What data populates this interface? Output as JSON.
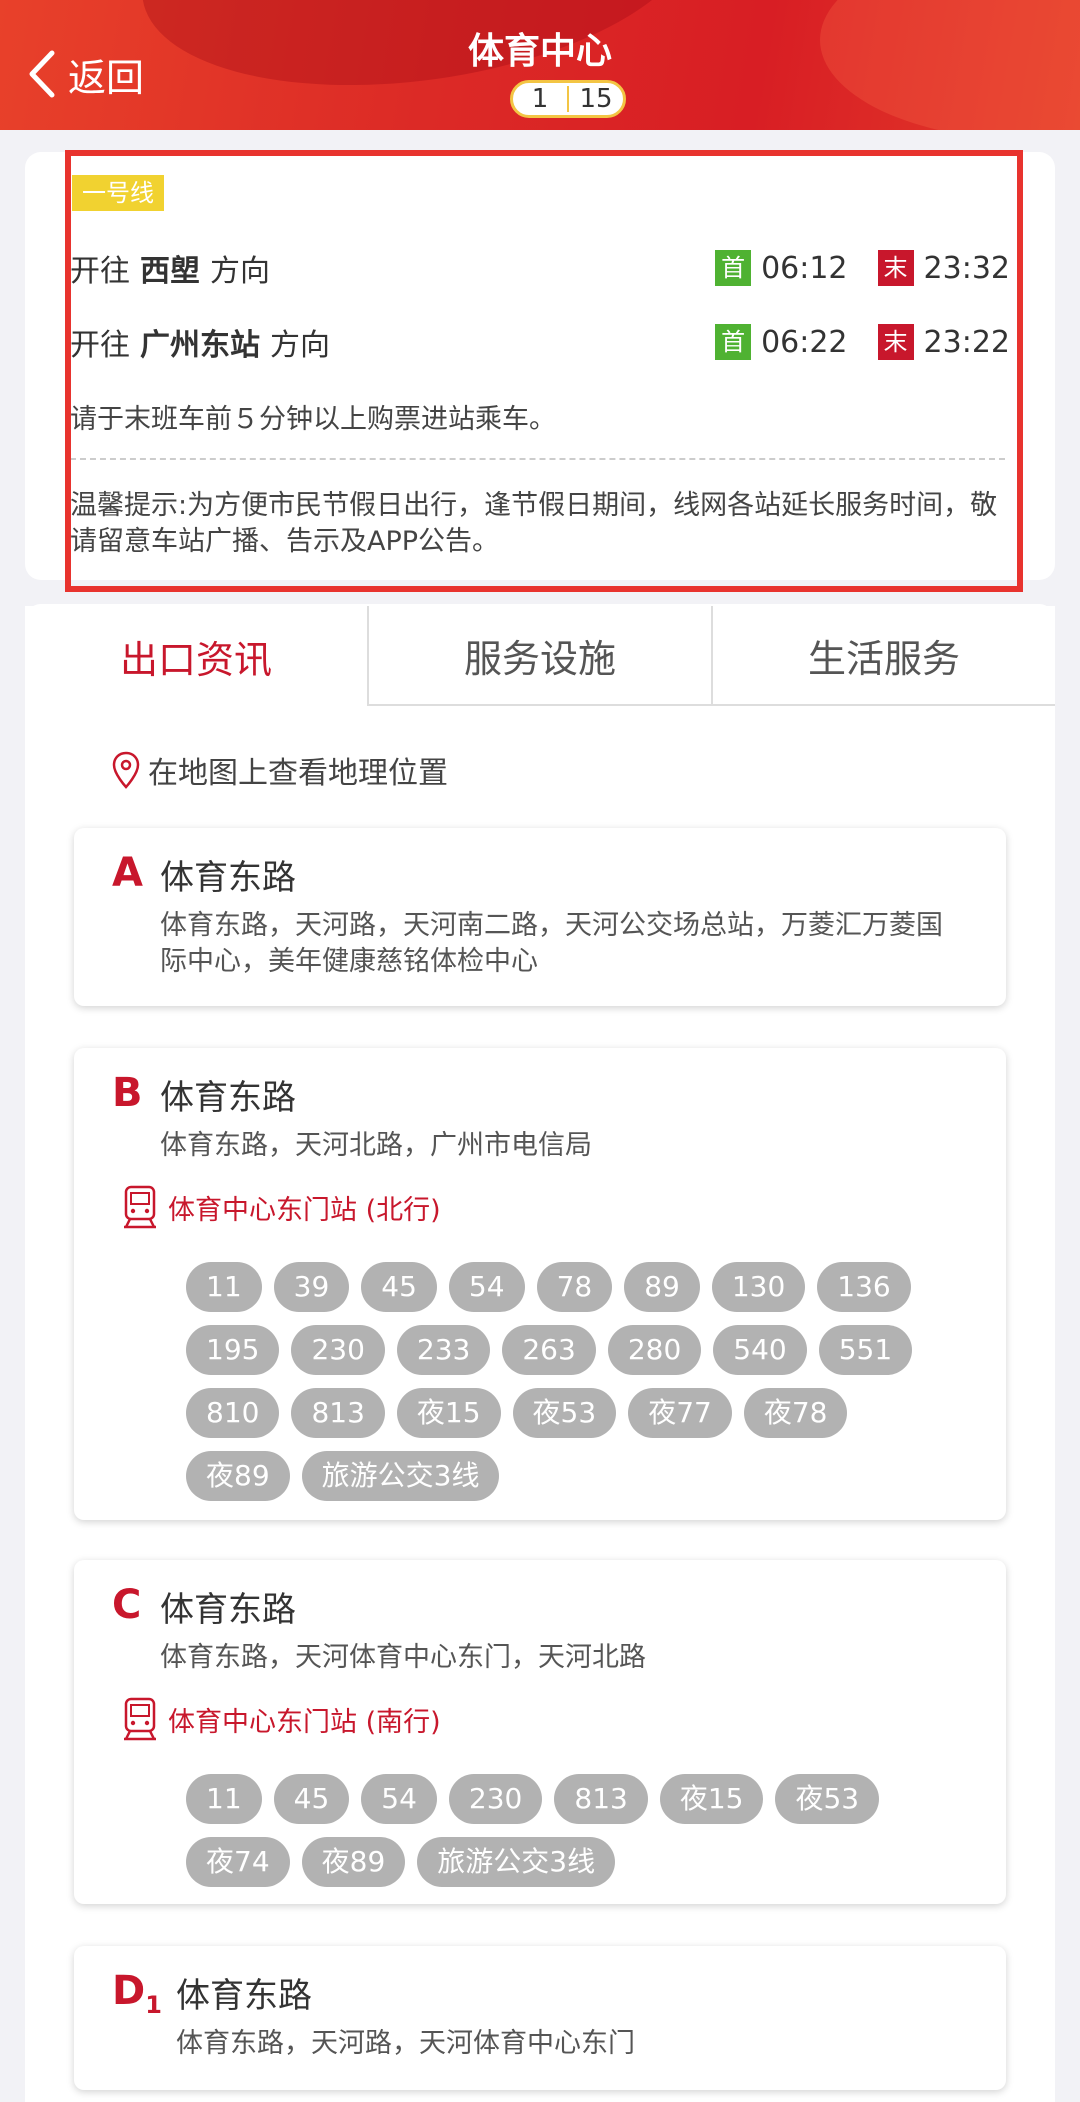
{
  "header": {
    "back_label": "返回",
    "title": "体育中心",
    "page_current": "1",
    "page_total": "15"
  },
  "info": {
    "line_name": "一号线",
    "directions": [
      {
        "prefix": "开往",
        "dest": "西塱",
        "suffix": "方向",
        "first_tag": "首",
        "first_time": "06:12",
        "last_tag": "末",
        "last_time": "23:32"
      },
      {
        "prefix": "开往",
        "dest": "广州东站",
        "suffix": "方向",
        "first_tag": "首",
        "first_time": "06:22",
        "last_tag": "末",
        "last_time": "23:22"
      }
    ],
    "notice1": "请于末班车前５分钟以上购票进站乘车。",
    "notice2": "温馨提示:为方便市民节假日出行，逢节假日期间，线网各站延长服务时间，敬请留意车站广播、告示及APP公告。"
  },
  "tabs": [
    "出口资讯",
    "服务设施",
    "生活服务"
  ],
  "active_tab": 0,
  "map_link": "在地图上查看地理位置",
  "exits": [
    {
      "letter": "A",
      "sub": "",
      "name": "体育东路",
      "roads": "体育东路，天河路，天河南二路，天河公交场总站，万菱汇万菱国际中心，美年健康慈铭体检中心"
    },
    {
      "letter": "B",
      "sub": "",
      "name": "体育东路",
      "roads": "体育东路，天河北路，广州市电信局",
      "bus_stop": "体育中心东门站 (北行)",
      "routes": [
        "11",
        "39",
        "45",
        "54",
        "78",
        "89",
        "130",
        "136",
        "195",
        "230",
        "233",
        "263",
        "280",
        "540",
        "551",
        "810",
        "813",
        "夜15",
        "夜53",
        "夜77",
        "夜78",
        "夜89",
        "旅游公交3线"
      ]
    },
    {
      "letter": "C",
      "sub": "",
      "name": "体育东路",
      "roads": "体育东路，天河体育中心东门，天河北路",
      "bus_stop": "体育中心东门站 (南行)",
      "routes": [
        "11",
        "45",
        "54",
        "230",
        "813",
        "夜15",
        "夜53",
        "夜74",
        "夜89",
        "旅游公交3线"
      ]
    },
    {
      "letter": "D",
      "sub": "1",
      "name": "体育东路",
      "roads": "体育东路，天河路，天河体育中心东门"
    }
  ],
  "colors": {
    "header_red": "#dc2a26",
    "accent_red": "#c8172c",
    "first_green": "#4fb232",
    "line_yellow": "#f1d230",
    "route_grey": "#b2b2b2"
  }
}
